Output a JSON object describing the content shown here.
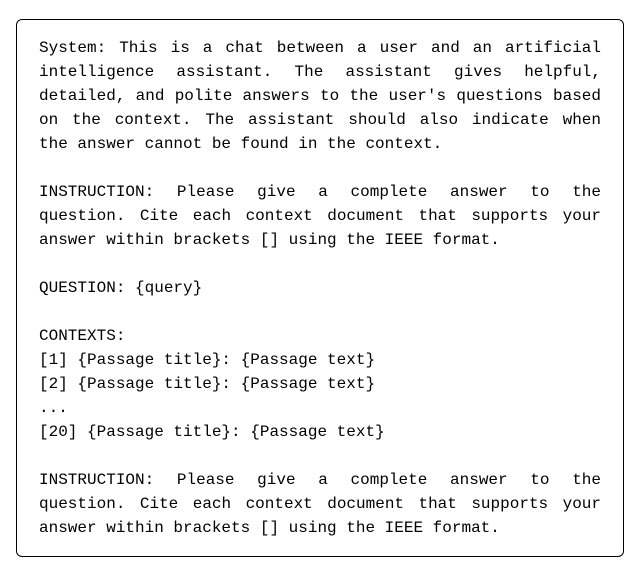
{
  "system_text": "System: This is a chat between a user and an artificial intelligence assistant. The assistant gives helpful, detailed, and polite answers to the user's questions based on the context. The assistant should also indicate when the answer cannot be found in the context.",
  "instruction_line1": "INSTRUCTION: Please give a complete answer to the",
  "instruction_line2": "question. Cite each context document that supports your",
  "instruction_line3": "answer within brackets [] using the IEEE format.",
  "question_line": "QUESTION: {query}",
  "contexts_heading": "CONTEXTS:",
  "context_item_1": "[1] {Passage title}: {Passage text}",
  "context_item_2": "[2] {Passage title}: {Passage text}",
  "context_ellipsis": "...",
  "context_item_20": "[20] {Passage title}: {Passage text}"
}
